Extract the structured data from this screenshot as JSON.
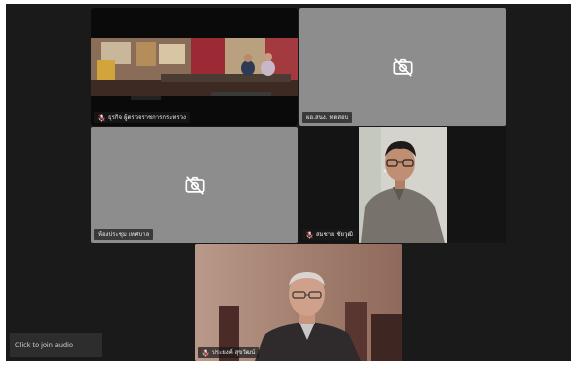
{
  "participants": [
    {
      "name": "ธุรกิจ ผู้ตรวจราชการกระทรวง",
      "video": true,
      "muted": true,
      "active": true
    },
    {
      "name": "ผอ.สนง. ทดสอบ",
      "video": false,
      "muted": false,
      "active": false
    },
    {
      "name": "ห้องประชุม เทศบาล",
      "video": false,
      "muted": false,
      "active": false
    },
    {
      "name": "สมชาย ชัยวุฒิ",
      "video": true,
      "muted": true,
      "active": false
    },
    {
      "name": "ประยงค์ สุขวัฒน์",
      "video": true,
      "muted": true,
      "active": false
    }
  ],
  "join_audio": {
    "label": "Click to join audio"
  },
  "colors": {
    "active_border": "#23d959",
    "muted_mic": "#e02828",
    "tile_off": "#8d8d8e",
    "background": "#1a1a1a"
  },
  "icons": {
    "camera_off": "camera-off-icon",
    "mic_muted": "mic-muted-icon"
  }
}
